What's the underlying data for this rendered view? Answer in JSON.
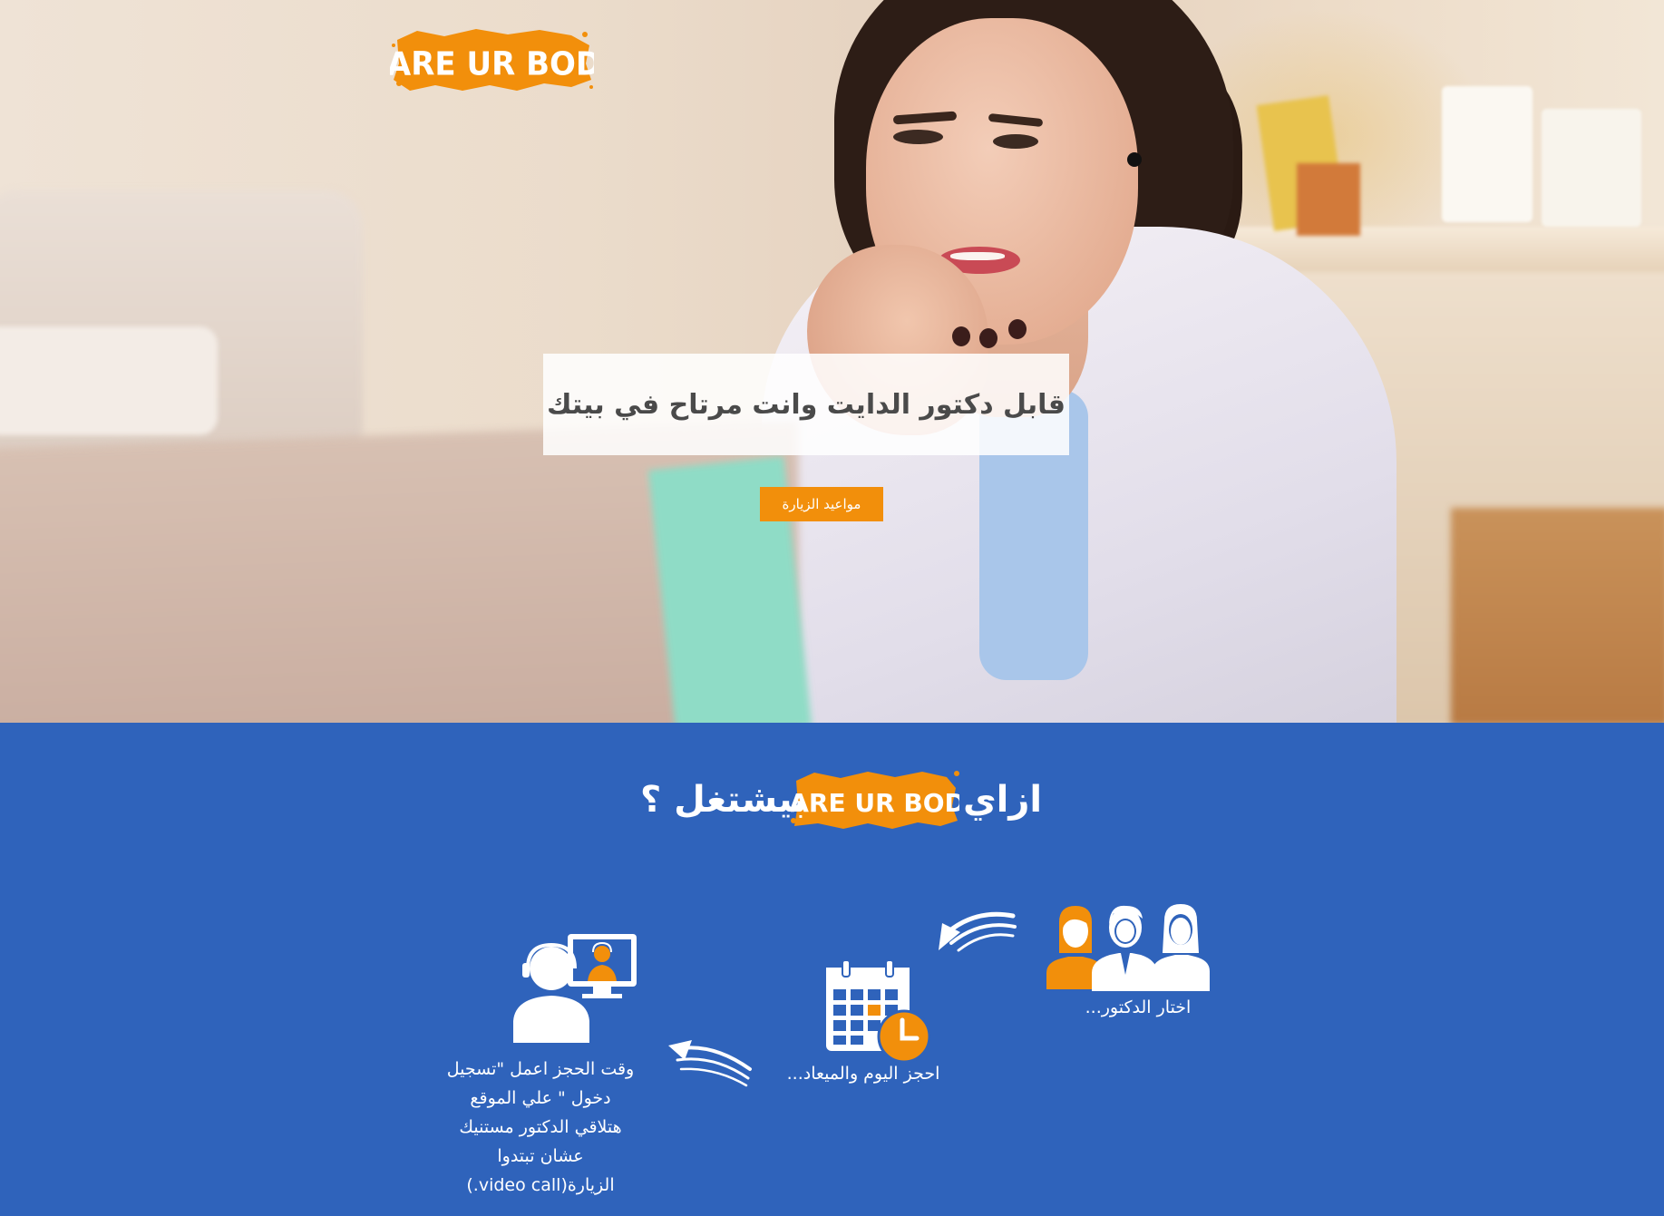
{
  "hero": {
    "brand_logo": "DARE UR BODY",
    "headline": "قابل دكتور الدايت وانت مرتاح في بيتك",
    "cta_label": "مواعيد الزيارة"
  },
  "how": {
    "title_prefix": "ازاي",
    "title_logo": "DARE UR BODY",
    "title_suffix": "بيشتغل ؟",
    "steps": [
      {
        "label": "اختار الدكتور...",
        "icon": "doctors-group-icon"
      },
      {
        "label": "احجز اليوم والميعاد...",
        "icon": "calendar-clock-icon"
      },
      {
        "label": "وقت الحجز اعمل \"تسجيل دخول \" علي الموقع هتلاقي الدكتور مستنيك عشان تبتدوا الزيارة(video call.)",
        "icon": "video-call-icon"
      }
    ]
  },
  "colors": {
    "accent_orange": "#f28f0b",
    "section_blue": "#2f63bb",
    "white": "#ffffff",
    "headline_gray": "#4a4a4a"
  }
}
